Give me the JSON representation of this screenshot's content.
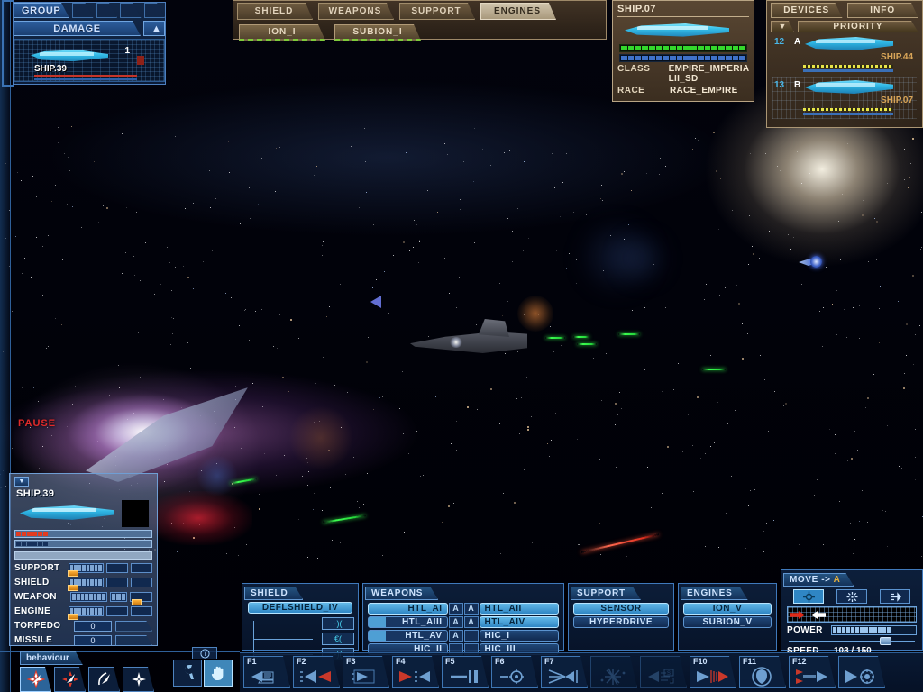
{
  "overlay": {
    "pause_label": "PAUSE"
  },
  "group_panel": {
    "title": "GROUP",
    "damage_label": "DAMAGE",
    "up_arrow": "▲",
    "slots": [
      "",
      "",
      "",
      ""
    ],
    "radar": {
      "count": "1",
      "ship_name": "SHIP.39"
    }
  },
  "system_tabs": {
    "tabs": [
      {
        "label": "SHIELD",
        "active": false
      },
      {
        "label": "WEAPONS",
        "active": false
      },
      {
        "label": "SUPPORT",
        "active": false
      },
      {
        "label": "ENGINES",
        "active": true
      }
    ],
    "subitems": [
      {
        "label": "ION_I"
      },
      {
        "label": "SUBION_I"
      }
    ]
  },
  "ship_info": {
    "id": "SHIP.07",
    "rows": [
      {
        "key": "CLASS",
        "value": "EMPIRE_IMPERIA LII_SD"
      },
      {
        "key": "RACE",
        "value": "RACE_EMPIRE"
      }
    ],
    "hull_segments": 18,
    "shield_segments": 18
  },
  "devices_panel": {
    "tabs": [
      {
        "label": "DEVICES"
      },
      {
        "label": "INFO"
      }
    ],
    "caret": "▼",
    "priority_label": "PRIORITY",
    "items": [
      {
        "index": "12",
        "group": "A",
        "name": "SHIP.44"
      },
      {
        "index": "13",
        "group": "B",
        "name": "SHIP.07"
      }
    ]
  },
  "ship_status": {
    "caret": "▼",
    "name": "SHIP.39",
    "hull_filled": 6,
    "hull_total": 38,
    "shield_filled": 6,
    "shield_total": 38,
    "systems": [
      {
        "label": "SUPPORT",
        "segments": 8,
        "boxes": 2,
        "small": false,
        "tab_on_meter": true,
        "tab_on_box": false
      },
      {
        "label": "SHIELD",
        "segments": 8,
        "boxes": 2,
        "small": false,
        "tab_on_meter": true,
        "tab_on_box": false
      },
      {
        "label": "WEAPON",
        "segments": 8,
        "boxes": 1,
        "small": true,
        "tab_on_meter": false,
        "tab_on_box": true
      },
      {
        "label": "ENGINE",
        "segments": 8,
        "boxes": 2,
        "small": false,
        "tab_on_meter": true,
        "tab_on_box": false
      }
    ],
    "ordnance": [
      {
        "label": "TORPEDO",
        "value": "0"
      },
      {
        "label": "MISSILE",
        "value": "0"
      }
    ]
  },
  "behaviour_panel": {
    "title": "behaviour",
    "buttons": [
      {
        "icon": "aggressive-icon",
        "active": true
      },
      {
        "icon": "defensive-icon",
        "active": false
      },
      {
        "icon": "evasive-icon",
        "active": false
      },
      {
        "icon": "neutral-icon",
        "active": false
      }
    ]
  },
  "tools_panel": {
    "info_icon": "info-icon",
    "buttons": [
      {
        "icon": "wrench-icon",
        "active": false
      },
      {
        "icon": "hand-icon",
        "active": true
      }
    ]
  },
  "equipment": {
    "shield": {
      "title": "SHIELD",
      "main": "DEFLSHIELD_IV",
      "nodes": [
        "-)(",
        "€(",
        "-)("
      ]
    },
    "weapons": {
      "title": "WEAPONS",
      "rows": [
        {
          "left": "HTL_AI",
          "left_ammo": "A",
          "left_state": "selected",
          "right_ammo": "A",
          "right": "HTL_AII",
          "right_state": "selected"
        },
        {
          "left": "HTL_AIII",
          "left_ammo": "A",
          "left_state": "partial",
          "right_ammo": "A",
          "right": "HTL_AIV",
          "right_state": "selected"
        },
        {
          "left": "HTL_AV",
          "left_ammo": "A",
          "left_state": "partial",
          "right_ammo": "",
          "right": "HIC_I",
          "right_state": "normal"
        },
        {
          "left": "HIC_II",
          "left_ammo": "",
          "left_state": "normal",
          "right_ammo": "",
          "right": "HIC_III",
          "right_state": "normal"
        }
      ]
    },
    "support": {
      "title": "SUPPORT",
      "items": [
        {
          "label": "SENSOR",
          "state": "selected"
        },
        {
          "label": "HYPERDRIVE",
          "state": "normal"
        }
      ]
    },
    "engines": {
      "title": "ENGINES",
      "items": [
        {
          "label": "ION_V",
          "state": "selected"
        },
        {
          "label": "SUBION_V",
          "state": "normal"
        }
      ]
    }
  },
  "move_panel": {
    "title": "MOVE ->",
    "target": "A",
    "buttons": [
      {
        "icon": "move-target-icon",
        "active": true
      },
      {
        "icon": "stop-icon",
        "active": false
      },
      {
        "icon": "formation-icon",
        "active": false
      }
    ],
    "power_label": "POWER",
    "power_segments": 13,
    "speed_label": "SPEED",
    "speed_value": "103 / 150"
  },
  "fkeys": [
    {
      "label": "F1",
      "icon": "report-icon",
      "dim": false
    },
    {
      "label": "F2",
      "icon": "attack-icon",
      "dim": false
    },
    {
      "label": "F3",
      "icon": "move-to-icon",
      "dim": false
    },
    {
      "label": "F4",
      "icon": "retreat-icon",
      "dim": false
    },
    {
      "label": "F5",
      "icon": "halt-icon",
      "dim": false
    },
    {
      "label": "F6",
      "icon": "target-icon",
      "dim": false
    },
    {
      "label": "F7",
      "icon": "converge-icon",
      "dim": false
    },
    {
      "label": "",
      "icon": "burst-icon",
      "dim": true
    },
    {
      "label": "",
      "icon": "scan-icon",
      "dim": true
    },
    {
      "label": "F10",
      "icon": "fire-forward-icon",
      "dim": false
    },
    {
      "label": "F11",
      "icon": "shield-icon",
      "dim": false
    },
    {
      "label": "F12",
      "icon": "escort-icon",
      "dim": false
    },
    {
      "label": "",
      "icon": "hyperjump-icon",
      "dim": false
    }
  ],
  "colors": {
    "hud_blue": "#4d7fbe",
    "brown_panel": "#a08c6b",
    "accent_cyan": "#49d3ef",
    "accent_amber": "#e8b13c",
    "warn_red": "#e02a2a",
    "health_green": "#34d72c"
  }
}
